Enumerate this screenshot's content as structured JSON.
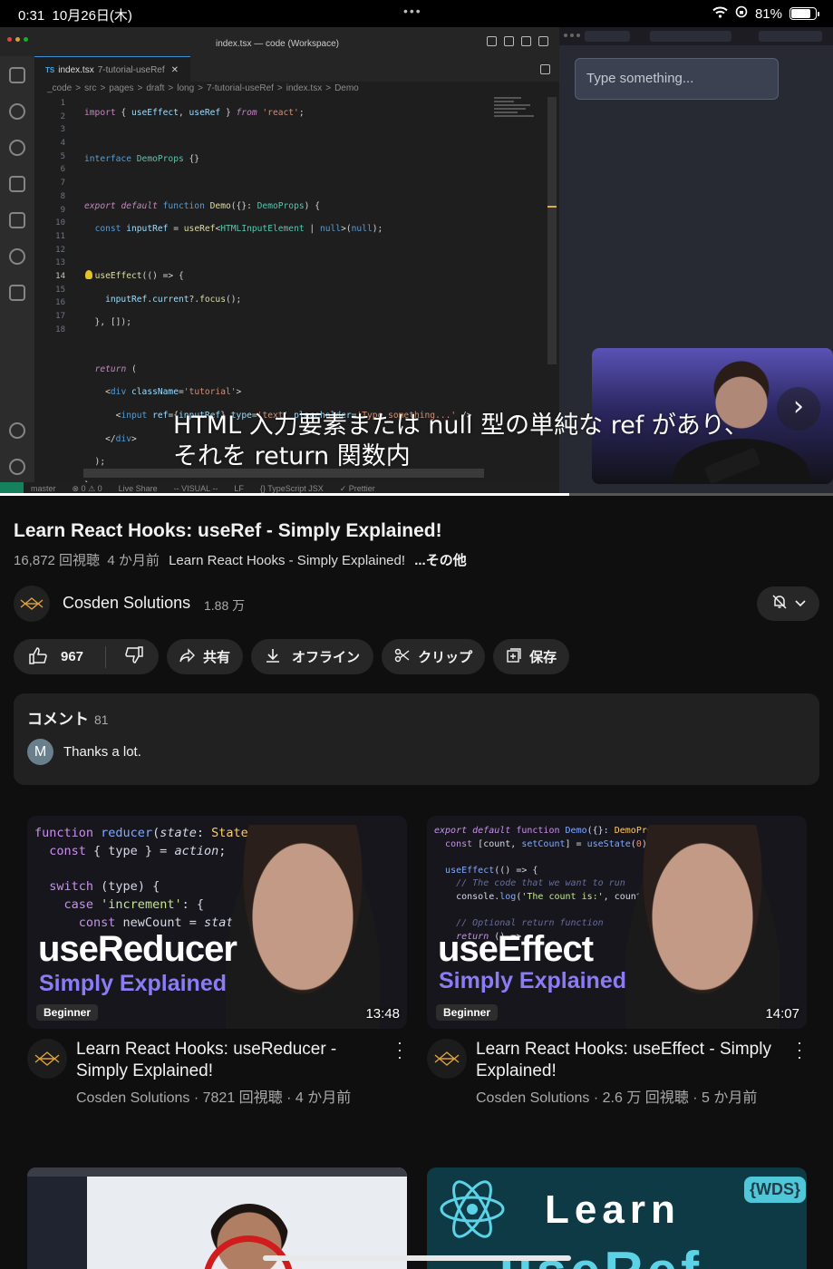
{
  "status_bar": {
    "time": "0:31",
    "date": "10月26日(木)",
    "battery": "81%",
    "battery_level": 0.81
  },
  "video": {
    "vscode": {
      "window_title": "index.tsx — code (Workspace)",
      "tab_name": "index.tsx",
      "tab_folder": "7-tutorial-useRef",
      "tab_lang": "TS",
      "breadcrumb": [
        "_code",
        "src",
        "pages",
        "draft",
        "long",
        "7-tutorial-useRef",
        "index.tsx",
        "Demo"
      ],
      "line_numbers": [
        "1",
        "2",
        "3",
        "4",
        "5",
        "6",
        "7",
        "8",
        "9",
        "10",
        "11",
        "12",
        "13",
        "14",
        "15",
        "16",
        "17",
        "18"
      ],
      "status_items": [
        "master",
        "⊗ 0 ⚠ 0",
        "Live Share",
        "-- VISUAL --",
        "LF",
        "{} TypeScript JSX",
        "✓ Prettier"
      ]
    },
    "browser": {
      "input_placeholder": "Type something..."
    },
    "subtitle_line1": "HTML 入力要素または null 型の単純な ref があり、",
    "subtitle_line2": "それを return 関数内",
    "progress": 0.683
  },
  "info": {
    "title": "Learn React Hooks: useRef - Simply Explained!",
    "views": "16,872 回視聴",
    "age": "4 か月前",
    "desc_snippet": "Learn React Hooks - Simply Explained!",
    "more": "...その他",
    "channel": "Cosden Solutions",
    "subscribers": "1.88 万"
  },
  "actions": {
    "likes": "967",
    "share": "共有",
    "offline": "オフライン",
    "clip": "クリップ",
    "save": "保存"
  },
  "comments": {
    "header": "コメント",
    "count": "81",
    "avatar_letter": "M",
    "top_comment": "Thanks a lot."
  },
  "recommendations": [
    {
      "title": "Learn React Hooks: useReducer - Simply Explained!",
      "meta": "Cosden Solutions · 7821 回視聴 · 4 か月前",
      "duration": "13:48",
      "thumb_big": "useReducer",
      "thumb_sub": "Simply Explained",
      "badge": "Beginner"
    },
    {
      "title": "Learn React Hooks: useEffect - Simply Explained!",
      "meta": "Cosden Solutions · 2.6 万 回視聴 · 5 か月前",
      "duration": "14:07",
      "thumb_big": "useEffect",
      "thumb_sub": "Simply Explained",
      "badge": "Beginner"
    }
  ],
  "recommendations_partial": {
    "thumb4_word": "Learn",
    "thumb4_badge": "{WDS}",
    "thumb4_bottom": "useRef"
  }
}
